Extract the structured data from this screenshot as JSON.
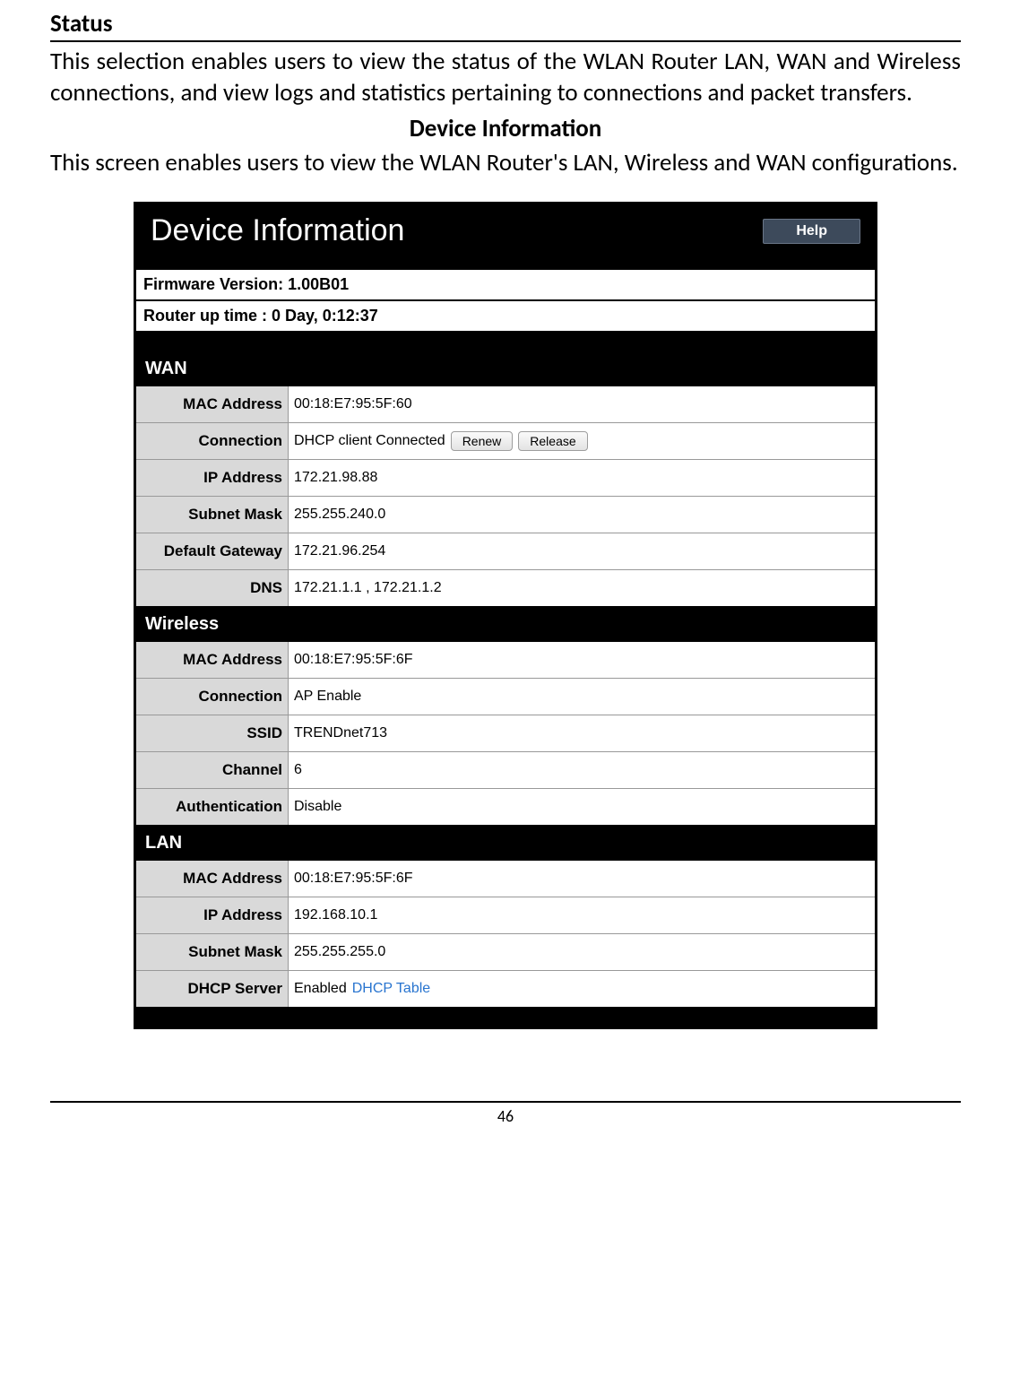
{
  "doc": {
    "heading": "Status",
    "intro": "This selection enables users to view the status of the WLAN Router LAN, WAN and Wireless connections, and view logs and statistics pertaining to connections and packet transfers.",
    "sub_heading": "Device Information",
    "sub_text": "This screen enables users to view the WLAN Router's LAN, Wireless and WAN configurations.",
    "page_number": "46"
  },
  "panel": {
    "title": "Device Information",
    "help_label": "Help",
    "firmware_label": "Firmware Version: ",
    "firmware_value": "1.00B01",
    "uptime_label": "Router up time :  ",
    "uptime_value": "0 Day, 0:12:37"
  },
  "wan": {
    "section": "WAN",
    "mac_label": "MAC Address",
    "mac_value": "00:18:E7:95:5F:60",
    "conn_label": "Connection",
    "conn_value": "DHCP client  Connected",
    "renew_btn": "Renew",
    "release_btn": "Release",
    "ip_label": "IP Address",
    "ip_value": "172.21.98.88",
    "subnet_label": "Subnet Mask",
    "subnet_value": "255.255.240.0",
    "gw_label": "Default Gateway",
    "gw_value": "172.21.96.254",
    "dns_label": "DNS",
    "dns_value": "172.21.1.1 , 172.21.1.2"
  },
  "wireless": {
    "section": "Wireless",
    "mac_label": "MAC Address",
    "mac_value": "00:18:E7:95:5F:6F",
    "conn_label": "Connection",
    "conn_value": "AP Enable",
    "ssid_label": "SSID",
    "ssid_value": "TRENDnet713",
    "channel_label": "Channel",
    "channel_value": "6",
    "auth_label": "Authentication",
    "auth_value": "Disable"
  },
  "lan": {
    "section": "LAN",
    "mac_label": "MAC Address",
    "mac_value": "00:18:E7:95:5F:6F",
    "ip_label": "IP Address",
    "ip_value": "192.168.10.1",
    "subnet_label": "Subnet Mask",
    "subnet_value": "255.255.255.0",
    "dhcp_label": "DHCP Server",
    "dhcp_value": "Enabled",
    "dhcp_link": "DHCP Table"
  }
}
